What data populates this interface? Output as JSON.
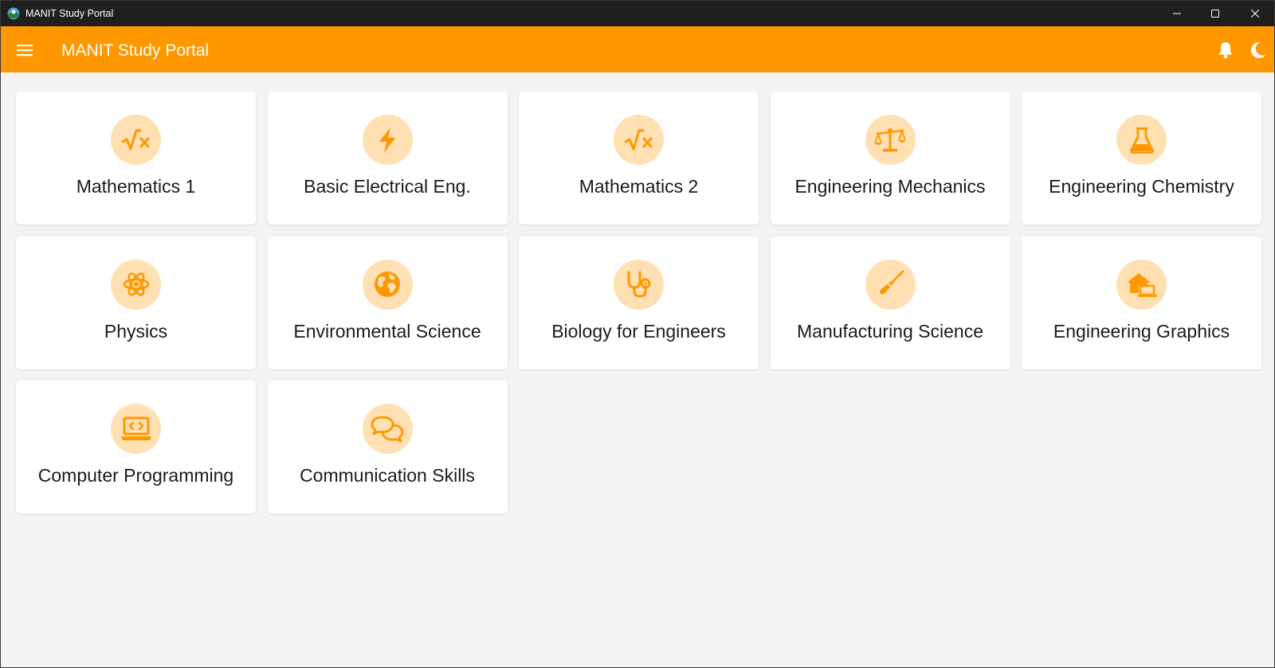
{
  "window": {
    "title": "MANIT Study Portal",
    "controls": [
      "minimize-icon",
      "maximize-icon",
      "close-icon"
    ]
  },
  "appbar": {
    "title": "MANIT Study Portal",
    "menu_icon": "hamburger-menu-icon",
    "actions": [
      "bell-icon",
      "moon-icon"
    ],
    "background_color": "#ff9800"
  },
  "theme": {
    "accent": "#ff9800",
    "icon_circle_bg": "#ffe0b3",
    "page_bg": "#f3f3f3",
    "card_bg": "#ffffff",
    "text": "#1a1a1a"
  },
  "subjects": [
    {
      "label": "Mathematics 1",
      "icon": "square-root-icon"
    },
    {
      "label": "Basic Electrical Eng.",
      "icon": "lightning-bolt-icon"
    },
    {
      "label": "Mathematics 2",
      "icon": "square-root-icon"
    },
    {
      "label": "Engineering Mechanics",
      "icon": "balance-scale-icon"
    },
    {
      "label": "Engineering Chemistry",
      "icon": "flask-icon"
    },
    {
      "label": "Physics",
      "icon": "atom-icon"
    },
    {
      "label": "Environmental Science",
      "icon": "globe-icon"
    },
    {
      "label": "Biology for Engineers",
      "icon": "stethoscope-icon"
    },
    {
      "label": "Manufacturing Science",
      "icon": "screwdriver-icon"
    },
    {
      "label": "Engineering Graphics",
      "icon": "house-laptop-icon"
    },
    {
      "label": "Computer Programming",
      "icon": "laptop-code-icon"
    },
    {
      "label": "Communication Skills",
      "icon": "chat-bubbles-icon"
    }
  ]
}
